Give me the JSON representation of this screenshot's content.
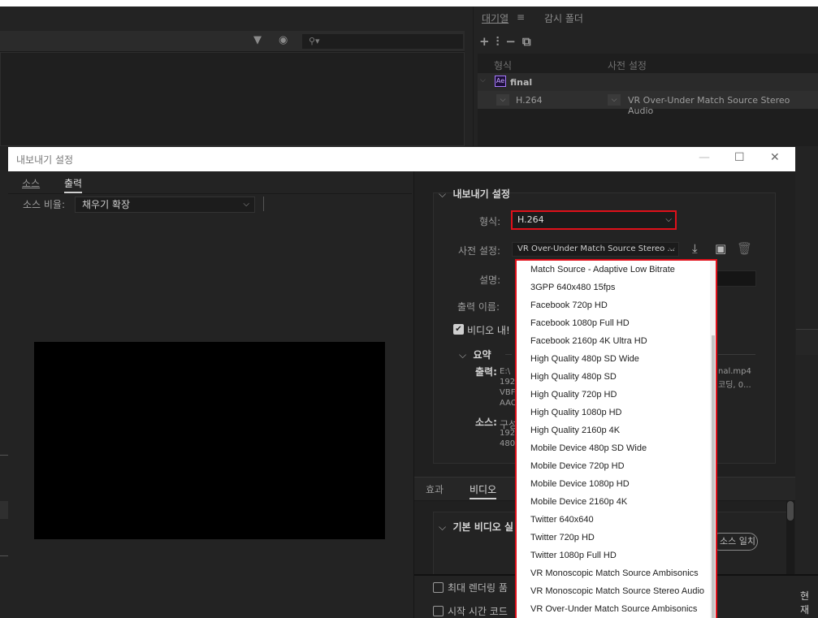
{
  "queue_panel": {
    "tab_queue": "대기열",
    "tab_watch": "감시 폴더",
    "col_format": "형식",
    "col_preset": "사전 설정",
    "item_app_badge": "Ae",
    "item_name": "final",
    "item_format": "H.264",
    "item_preset": "VR Over-Under Match Source Stereo Audio"
  },
  "dialog": {
    "title": "내보내기 설정",
    "tabs": {
      "source": "소스",
      "output": "출력"
    },
    "source_ratio_label": "소스 비율:",
    "source_ratio_value": "채우기 확장",
    "export_settings": {
      "heading": "내보내기 설정",
      "format_label": "형식:",
      "format_value": "H.264",
      "preset_label": "사전 설정:",
      "preset_value": "VR Over-Under Match Source Stereo ...",
      "description_label": "설명:",
      "output_name_label": "출력 이름:",
      "export_video_label": "비디오 내!",
      "summary_heading": "요약",
      "summary_output_label": "출력:",
      "summary_output_lines": [
        "E:\\",
        "192",
        "VBF",
        "AAC"
      ],
      "summary_output_right": [
        "nal.mp4",
        "코딩, 0..."
      ],
      "summary_source_label": "소스:",
      "summary_source_lines": [
        "구성",
        "192",
        "480"
      ]
    },
    "bottom_tabs": {
      "effects": "효과",
      "video": "비디오"
    },
    "basic_video_heading": "기본 비디오 실",
    "match_button_label": "소스 일치",
    "bottom_checks": [
      "최대 렌더링 품",
      "시작 시간 코드"
    ],
    "current_label": "현재",
    "preset_options": [
      "Match Source - Adaptive Low Bitrate",
      "3GPP 640x480 15fps",
      "Facebook 720p HD",
      "Facebook 1080p Full HD",
      "Facebook 2160p 4K Ultra HD",
      "High Quality 480p SD Wide",
      "High Quality 480p SD",
      "High Quality 720p HD",
      "High Quality 1080p HD",
      "High Quality 2160p 4K",
      "Mobile Device 480p SD Wide",
      "Mobile Device 720p HD",
      "Mobile Device 1080p HD",
      "Mobile Device 2160p 4K",
      "Twitter 640x640",
      "Twitter 720p HD",
      "Twitter 1080p Full HD",
      "VR Monoscopic Match Source Ambisonics",
      "VR Monoscopic Match Source Stereo Audio",
      "VR Over-Under Match Source Ambisonics"
    ]
  },
  "colors": {
    "highlight_border": "#e0101a",
    "dialog_bg": "#232323",
    "dropdown_bg": "#ffffff"
  }
}
